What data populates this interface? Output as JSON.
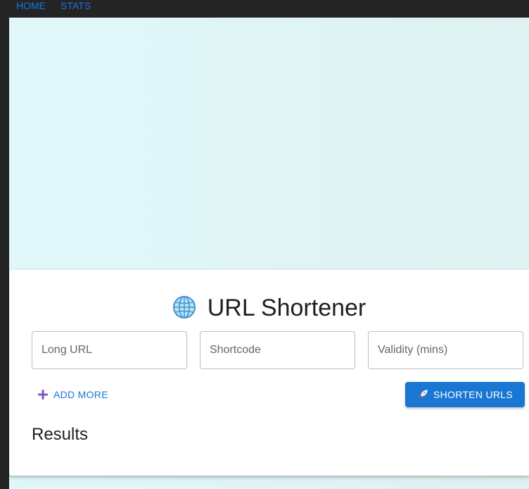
{
  "nav": {
    "home": "HOME",
    "stats": "STATS"
  },
  "form": {
    "title": "URL Shortener",
    "long_url_placeholder": "Long URL",
    "shortcode_placeholder": "Shortcode",
    "validity_placeholder": "Validity (mins)",
    "add_more_label": "ADD MORE",
    "shorten_label": "SHORTEN URLS",
    "results_heading": "Results"
  },
  "icons": {
    "title": "globe-icon",
    "add_more": "plus-icon",
    "shorten": "rocket-icon"
  },
  "colors": {
    "primary": "#1976d2",
    "nav_link": "#1a73e8",
    "topbar": "#242424",
    "background": "#e0f7fa",
    "plus": "#7e57c2"
  }
}
